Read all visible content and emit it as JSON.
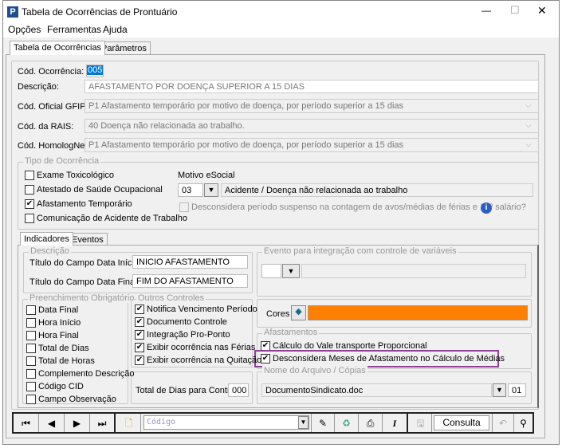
{
  "window": {
    "title": "Tabela de Ocorrências de Prontuário",
    "min": "—",
    "max": "☐",
    "close": "✕"
  },
  "menu": [
    "Opções",
    "Ferramentas",
    "Ajuda"
  ],
  "tabs": [
    "Tabela de Ocorrências",
    "Parâmetros"
  ],
  "form": {
    "cod_ocorrencia_label": "Cód. Ocorrência:",
    "cod_ocorrencia": "005",
    "descricao_label": "Descrição:",
    "descricao": "AFASTAMENTO POR DOENÇA SUPERIOR A 15 DIAS",
    "gfip_label": "Cód. Oficial GFIP:",
    "gfip": "P1 Afastamento temporário por motivo de doença, por período superior a 15 dias",
    "rais_label": "Cód. da RAIS:",
    "rais": "40 Doença não relacionada ao trabalho.",
    "homolog_label": "Cód. HomologNet:",
    "homolog": "P1  Afastamento temporário por motivo de doença, por período superior a 15 dias"
  },
  "tipo": {
    "title": "Tipo de Ocorrência",
    "items": [
      {
        "label": "Exame Toxicológico",
        "checked": false
      },
      {
        "label": "Atestado de Saúde Ocupacional",
        "checked": false
      },
      {
        "label": "Afastamento Temporário",
        "checked": true
      },
      {
        "label": "Comunicação de Acidente de Trabalho",
        "checked": false
      }
    ],
    "motivo_label": "Motivo eSocial",
    "motivo_code": "03",
    "motivo_text": "Acidente / Doença não relacionada ao trabalho",
    "desconsidera": "Desconsidera período suspenso na contagem de avos/médias de férias e 13º salário?"
  },
  "subtabs": [
    "Indicadores",
    "Eventos"
  ],
  "descricao_group": {
    "title": "Descrição",
    "inicio_label": "Título do Campo Data Início:",
    "inicio": "INICIO AFASTAMENTO",
    "final_label": "Título do Campo Data Final:",
    "final": "FIM DO AFASTAMENTO"
  },
  "evento_group": {
    "title": "Evento para integração com controle de variáveis"
  },
  "preenchimento": {
    "title": "Preenchimento Obrigatório",
    "items": [
      "Data Final",
      "Hora Início",
      "Hora Final",
      "Total de Dias",
      "Total de Horas",
      "Complemento Descrição",
      "Código CID",
      "Campo Observação"
    ]
  },
  "outros": {
    "title": "Outros Controles",
    "items": [
      "Notifica Vencimento Período",
      "Documento Controle",
      "Integração Pro-Ponto",
      "Exibir ocorrência nas Férias",
      "Exibir ocorrência na Quitação"
    ]
  },
  "total_dias": {
    "label": "Total de Dias para Controle:",
    "value": "000"
  },
  "cores": {
    "label": "Cores",
    "color": "#ff8000"
  },
  "afastamentos": {
    "title": "Afastamentos",
    "items": [
      "Cálculo do Vale transporte Proporcional",
      "Desconsidera Meses de Afastamento no Cálculo de Médias"
    ],
    "highlight": "#8e3f98"
  },
  "arquivo": {
    "title": "Nome do Arquivo / Cópias",
    "file": "DocumentoSindicato.doc",
    "copias": "01"
  },
  "toolbar": {
    "search_placeholder": "Código",
    "mode": "Consulta"
  }
}
